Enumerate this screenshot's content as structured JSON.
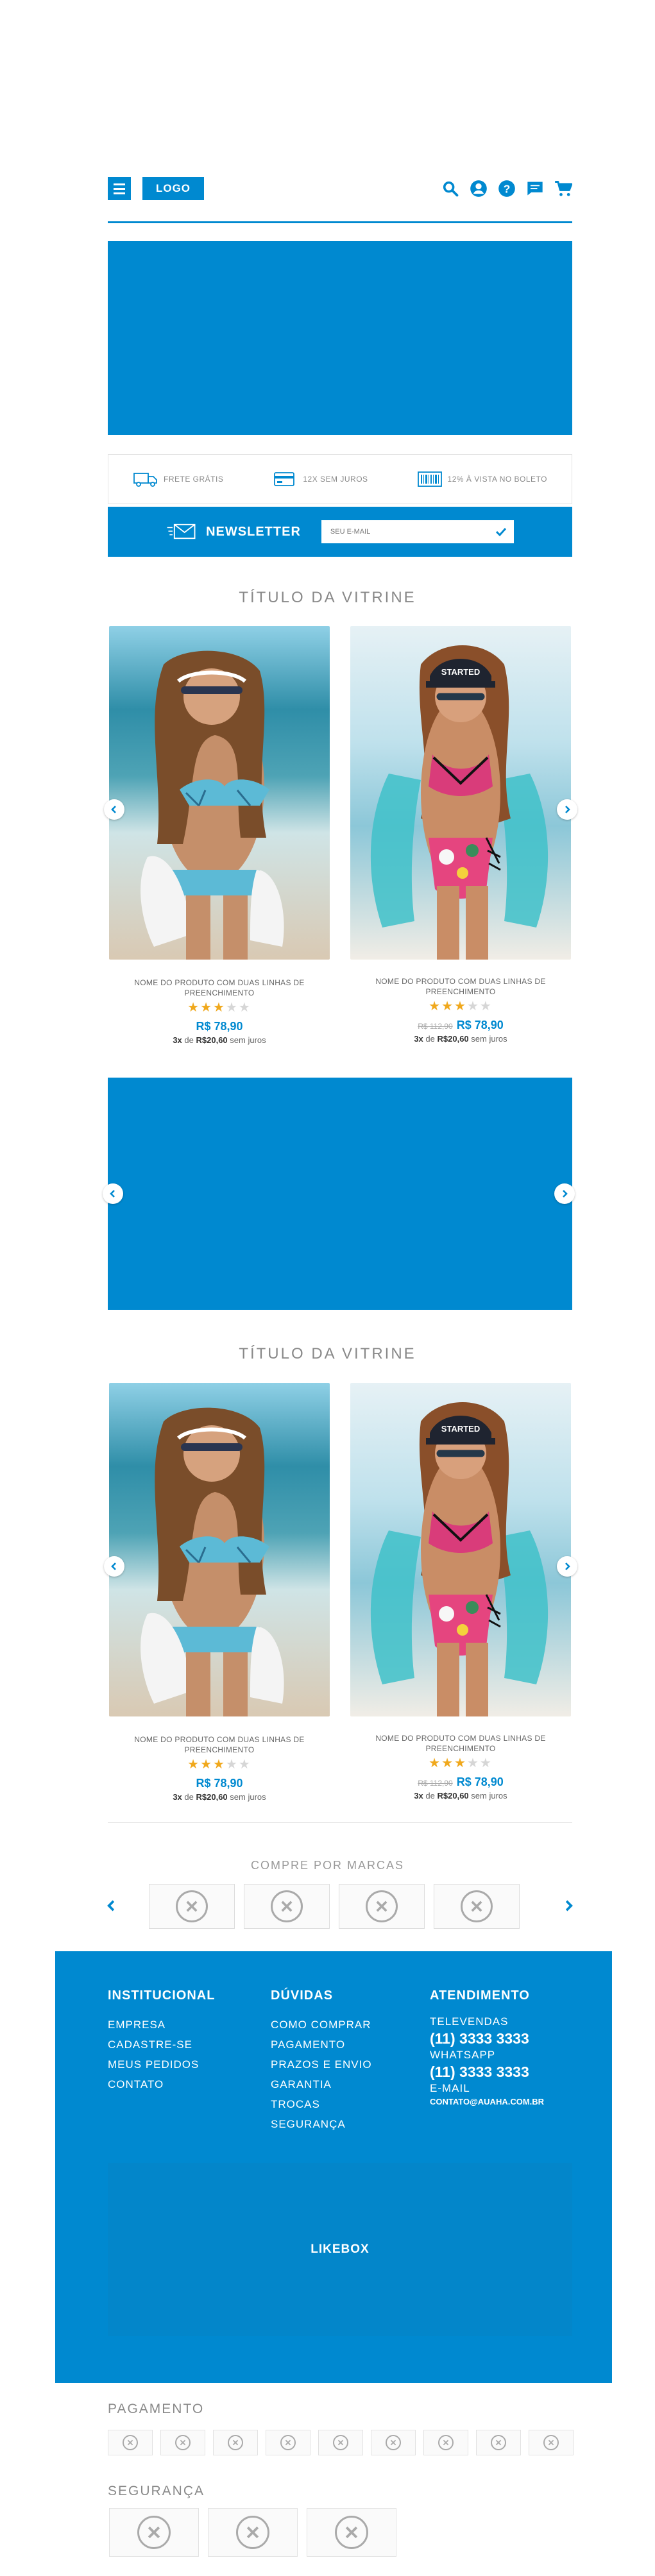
{
  "header": {
    "logo": "LOGO",
    "icons": [
      "search-icon",
      "user-icon",
      "help-icon",
      "chat-icon",
      "cart-icon"
    ]
  },
  "benefits": [
    {
      "icon": "truck-icon",
      "label": "FRETE GRÁTIS"
    },
    {
      "icon": "card-icon",
      "label": "12X SEM JUROS"
    },
    {
      "icon": "barcode-icon",
      "label": "12% À VISTA NO BOLETO"
    }
  ],
  "newsletter": {
    "title": "NEWSLETTER",
    "placeholder": "SEU E-MAIL"
  },
  "vitrine1": {
    "title": "TÍTULO DA VITRINE",
    "products": [
      {
        "name": "NOME DO PRODUTO COM DUAS LINHAS DE PREENCHIMENTO",
        "rating": 3,
        "old_price": "",
        "price": "R$ 78,90",
        "installments_count": "3x",
        "installments_sep": "de",
        "installment_value": "R$20,60",
        "installments_tail": "sem juros"
      },
      {
        "name": "NOME DO PRODUTO COM DUAS LINHAS DE PREENCHIMENTO",
        "rating": 3,
        "old_price": "R$ 112,90",
        "price": "R$ 78,90",
        "installments_count": "3x",
        "installments_sep": "de",
        "installment_value": "R$20,60",
        "installments_tail": "sem juros"
      }
    ]
  },
  "vitrine2": {
    "title": "TÍTULO DA VITRINE",
    "products": [
      {
        "name": "NOME DO PRODUTO COM DUAS LINHAS DE PREENCHIMENTO",
        "rating": 3,
        "old_price": "",
        "price": "R$ 78,90",
        "installments_count": "3x",
        "installments_sep": "de",
        "installment_value": "R$20,60",
        "installments_tail": "sem juros"
      },
      {
        "name": "NOME DO PRODUTO COM DUAS LINHAS DE PREENCHIMENTO",
        "rating": 3,
        "old_price": "R$ 112,90",
        "price": "R$ 78,90",
        "installments_count": "3x",
        "installments_sep": "de",
        "installment_value": "R$20,60",
        "installments_tail": "sem juros"
      }
    ]
  },
  "brands": {
    "title": "COMPRE POR MARCAS"
  },
  "footer": {
    "institucional": {
      "title": "INSTITUCIONAL",
      "links": [
        "EMPRESA",
        "CADASTRE-SE",
        "MEUS PEDIDOS",
        "CONTATO"
      ]
    },
    "duvidas": {
      "title": "DÚVIDAS",
      "links": [
        "COMO COMPRAR",
        "PAGAMENTO",
        "PRAZOS E ENVIO",
        "GARANTIA",
        "TROCAS",
        "SEGURANÇA"
      ]
    },
    "atendimento": {
      "title": "ATENDIMENTO",
      "televendas_label": "TELEVENDAS",
      "televendas_phone": "(11) 3333 3333",
      "whatsapp_label": "WHATSAPP",
      "whatsapp_phone": "(11) 3333 3333",
      "email_label": "E-MAIL",
      "email": "CONTATO@AUAHA.COM.BR"
    },
    "likebox": "LIKEBOX"
  },
  "pagamento": {
    "title": "PAGAMENTO"
  },
  "seguranca": {
    "title": "SEGURANÇA"
  },
  "colors": {
    "primary": "#0089d0",
    "star": "#f0a81c"
  }
}
